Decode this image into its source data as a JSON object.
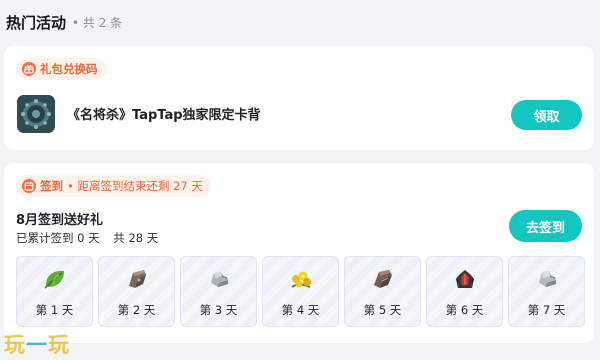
{
  "header": {
    "title": "热门活动",
    "count": "• 共 2 条"
  },
  "gift_card": {
    "tag": "礼包兑换码",
    "name": "《名将杀》TapTap独家限定卡背",
    "button": "领取"
  },
  "signin_card": {
    "tag": "签到",
    "tag_note": "• 距离签到结束还剩 27 天",
    "title": "8月签到送好礼",
    "signed": "已累计签到 0 天",
    "total": "共 28 天",
    "button": "去签到",
    "days": [
      {
        "label": "第 1 天",
        "icon": "green-leaf-icon"
      },
      {
        "label": "第 2 天",
        "icon": "armor-piece-icon"
      },
      {
        "label": "第 3 天",
        "icon": "silver-gauntlet-icon"
      },
      {
        "label": "第 4 天",
        "icon": "gold-coins-icon"
      },
      {
        "label": "第 5 天",
        "icon": "armor-piece-icon"
      },
      {
        "label": "第 6 天",
        "icon": "dark-armor-icon"
      },
      {
        "label": "第 7 天",
        "icon": "silver-gauntlet-icon"
      }
    ]
  },
  "watermark": {
    "part1": "玩",
    "part2": "一",
    "part3": "玩"
  },
  "colors": {
    "accent": "#15c5c0",
    "tag_orange": "#f0663a",
    "background": "#f3f4f6"
  }
}
